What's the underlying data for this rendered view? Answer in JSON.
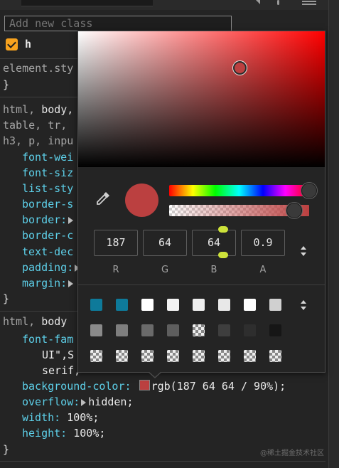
{
  "toolbar": {},
  "class_input": {
    "placeholder": "Add new class"
  },
  "class_toggle": {
    "label": "h",
    "checked": true
  },
  "rules": {
    "element_style": {
      "selector": "element.sty",
      "close": "}"
    },
    "rule1": {
      "sel_line1_a": "html, ",
      "sel_line1_b": "body,",
      "sel_line2": "table, tr,",
      "sel_line3": "h3, p, inpu",
      "props": [
        "font-wei",
        "font-siz",
        "list-sty",
        "border-s",
        "border:",
        "border-c",
        "text-dec",
        "padding:",
        "margin:"
      ],
      "close": "}"
    },
    "rule2": {
      "sel_a": "html, ",
      "sel_b": "body",
      "font_prop": "font-fam",
      "font_val1": "UI\",S",
      "font_val2": "serif,",
      "bg_prop": "background-color:",
      "bg_val": "rgb(187 64 64 / 90%);",
      "ov_prop": "overflow:",
      "ov_val": "hidden;",
      "w_prop": "width:",
      "w_val": "100%;",
      "h_prop": "height:",
      "h_val": "100%;",
      "close": "}"
    }
  },
  "color_picker": {
    "color_hex": "#bb4040",
    "hue_position": 1.0,
    "alpha": 0.9,
    "values": [
      {
        "value": "187",
        "label": "R"
      },
      {
        "value": "64",
        "label": "G"
      },
      {
        "value": "64",
        "label": "B"
      },
      {
        "value": "0.9",
        "label": "A"
      }
    ],
    "icons": {
      "eyedropper": "eyedropper-icon",
      "stepper": "stepper-icon"
    },
    "palette": [
      [
        "#0e7a9a",
        "#0e7a9a",
        "#ffffff",
        "#f3f3f3",
        "#eeeeee",
        "#e8e8e8",
        "#ffffff",
        "#d0d0d0"
      ],
      [
        "#8a8a8a",
        "#7e7e7e",
        "#6a6a6a",
        "#5e5e5e",
        "checker",
        "#3e3e3e",
        "#2e2e2e",
        "#161616"
      ],
      [
        "checker",
        "checker",
        "checker",
        "checker",
        "checker",
        "checker",
        "checker",
        "checker"
      ]
    ]
  },
  "watermark": "@稀土掘金技术社区"
}
